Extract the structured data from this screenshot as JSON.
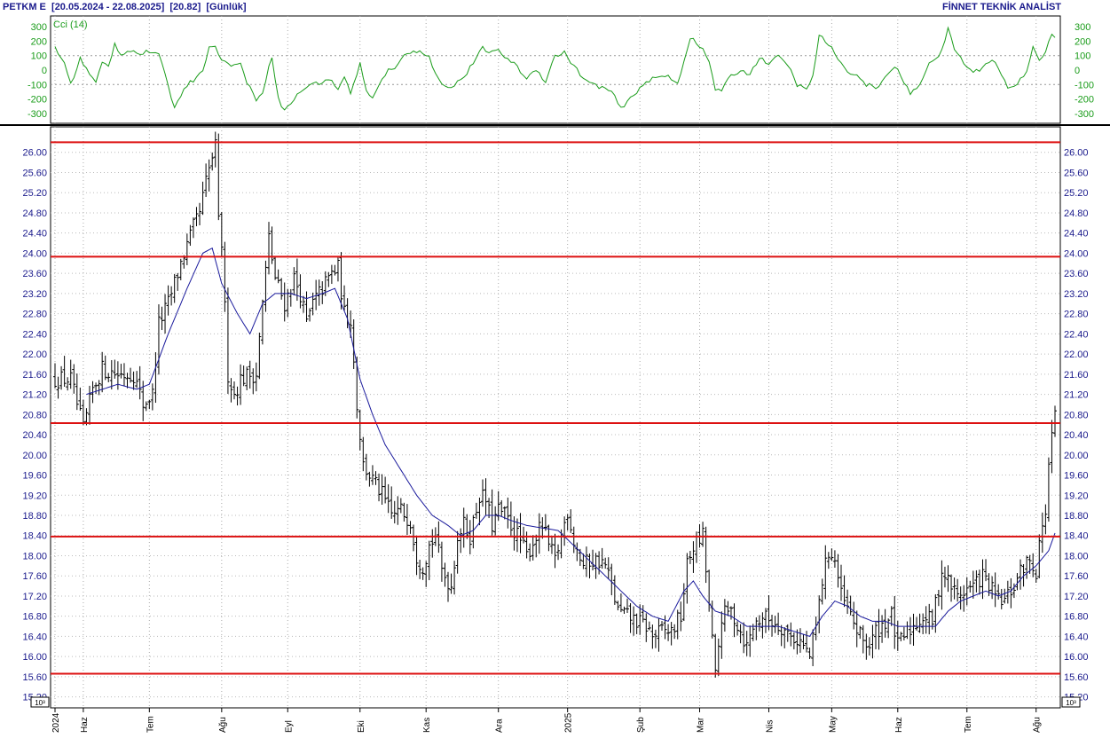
{
  "header": {
    "symbol": "PETKM E",
    "range": "[20.05.2024 - 22.08.2025]",
    "last": "[20.82]",
    "period": "[Günlük]",
    "source": "FİNNET TEKNİK ANALİST"
  },
  "cci_panel": {
    "label": "Cci (14)",
    "ylim": [
      -350,
      350
    ],
    "ticks": [
      300,
      200,
      100,
      0,
      -100,
      -200,
      -300
    ],
    "tick_labels": [
      "300",
      "200",
      "100",
      "0",
      "-100",
      "-200",
      "-300"
    ],
    "dotted_levels": [
      100,
      -100
    ],
    "color": "#1a9c1a"
  },
  "price_panel": {
    "ylim": [
      15.0,
      26.4
    ],
    "ticks": [
      15.2,
      15.6,
      16.0,
      16.4,
      16.8,
      17.2,
      17.6,
      18.0,
      18.4,
      18.8,
      19.2,
      19.6,
      20.0,
      20.4,
      20.8,
      21.2,
      21.6,
      22.0,
      22.4,
      22.8,
      23.2,
      23.6,
      24.0,
      24.4,
      24.8,
      25.2,
      25.6,
      26.0
    ],
    "tick_labels": [
      "15.20",
      "15.60",
      "16.00",
      "16.40",
      "16.80",
      "17.20",
      "17.60",
      "18.00",
      "18.40",
      "18.80",
      "19.20",
      "19.60",
      "20.00",
      "20.40",
      "20.80",
      "21.20",
      "21.60",
      "22.00",
      "22.40",
      "22.80",
      "23.20",
      "23.60",
      "24.00",
      "24.40",
      "24.80",
      "25.20",
      "25.60",
      "26.00"
    ],
    "multiplier_label": "10^3",
    "horizontal_lines": [
      26.2,
      23.93,
      20.63,
      18.38,
      15.66
    ],
    "line_color": "#dd1111",
    "ma_color": "#1a1a9c",
    "bar_color": "#000000"
  },
  "x_axis": {
    "labels": [
      "2024",
      "Haz",
      "Tem",
      "Ağu",
      "Eyl",
      "Eki",
      "Kas",
      "Ara",
      "2025",
      "Şub",
      "Mar",
      "Nis",
      "May",
      "Haz",
      "Tem",
      "Ağu"
    ],
    "label_index": [
      0,
      9,
      30,
      53,
      74,
      97,
      118,
      141,
      163,
      186,
      205,
      227,
      247,
      268,
      290,
      312
    ]
  },
  "chart_data": {
    "type": "ohlc",
    "price_keypoints": [
      [
        0,
        21.5
      ],
      [
        5,
        21.5
      ],
      [
        9,
        20.5
      ],
      [
        12,
        21.3
      ],
      [
        15,
        21.7
      ],
      [
        20,
        21.6
      ],
      [
        25,
        21.6
      ],
      [
        28,
        21.0
      ],
      [
        31,
        21.2
      ],
      [
        33,
        22.6
      ],
      [
        36,
        23.0
      ],
      [
        40,
        23.8
      ],
      [
        44,
        24.5
      ],
      [
        46,
        24.8
      ],
      [
        48,
        25.4
      ],
      [
        50,
        25.9
      ],
      [
        51,
        26.1
      ],
      [
        52,
        24.6
      ],
      [
        53,
        24.2
      ],
      [
        55,
        21.6
      ],
      [
        57,
        21.2
      ],
      [
        59,
        21.5
      ],
      [
        62,
        21.6
      ],
      [
        64,
        21.6
      ],
      [
        66,
        23.0
      ],
      [
        68,
        24.3
      ],
      [
        70,
        23.5
      ],
      [
        73,
        23.0
      ],
      [
        76,
        23.5
      ],
      [
        78,
        23.2
      ],
      [
        80,
        22.6
      ],
      [
        82,
        23.0
      ],
      [
        85,
        23.3
      ],
      [
        88,
        23.6
      ],
      [
        90,
        23.7
      ],
      [
        92,
        22.8
      ],
      [
        94,
        22.7
      ],
      [
        96,
        21.0
      ],
      [
        98,
        19.8
      ],
      [
        101,
        19.5
      ],
      [
        104,
        19.2
      ],
      [
        107,
        18.8
      ],
      [
        110,
        18.9
      ],
      [
        113,
        18.7
      ],
      [
        115,
        18.0
      ],
      [
        117,
        17.8
      ],
      [
        119,
        18.2
      ],
      [
        121,
        18.4
      ],
      [
        123,
        17.7
      ],
      [
        126,
        17.4
      ],
      [
        128,
        18.4
      ],
      [
        130,
        18.6
      ],
      [
        132,
        18.4
      ],
      [
        135,
        19.2
      ],
      [
        137,
        19.1
      ],
      [
        139,
        18.6
      ],
      [
        141,
        18.9
      ],
      [
        143,
        18.8
      ],
      [
        145,
        18.6
      ],
      [
        148,
        18.3
      ],
      [
        150,
        18.0
      ],
      [
        153,
        18.4
      ],
      [
        155,
        18.6
      ],
      [
        157,
        18.2
      ],
      [
        159,
        17.9
      ],
      [
        161,
        18.4
      ],
      [
        163,
        18.9
      ],
      [
        165,
        18.3
      ],
      [
        168,
        17.8
      ],
      [
        170,
        17.9
      ],
      [
        173,
        17.9
      ],
      [
        175,
        17.8
      ],
      [
        177,
        17.4
      ],
      [
        179,
        16.9
      ],
      [
        182,
        16.8
      ],
      [
        185,
        16.7
      ],
      [
        188,
        16.6
      ],
      [
        190,
        16.4
      ],
      [
        193,
        16.5
      ],
      [
        196,
        16.5
      ],
      [
        199,
        16.8
      ],
      [
        201,
        17.8
      ],
      [
        203,
        18.2
      ],
      [
        205,
        18.3
      ],
      [
        206,
        18.4
      ],
      [
        208,
        17.0
      ],
      [
        210,
        15.6
      ],
      [
        212,
        16.8
      ],
      [
        215,
        16.9
      ],
      [
        218,
        16.5
      ],
      [
        220,
        16.2
      ],
      [
        222,
        16.6
      ],
      [
        225,
        16.8
      ],
      [
        228,
        16.7
      ],
      [
        231,
        16.6
      ],
      [
        234,
        16.4
      ],
      [
        237,
        16.3
      ],
      [
        240,
        16.0
      ],
      [
        242,
        16.6
      ],
      [
        244,
        17.5
      ],
      [
        246,
        18.1
      ],
      [
        248,
        17.9
      ],
      [
        250,
        17.2
      ],
      [
        253,
        16.8
      ],
      [
        256,
        16.4
      ],
      [
        259,
        16.2
      ],
      [
        261,
        16.5
      ],
      [
        264,
        16.7
      ],
      [
        266,
        16.8
      ],
      [
        268,
        16.2
      ],
      [
        270,
        16.4
      ],
      [
        273,
        16.6
      ],
      [
        276,
        16.8
      ],
      [
        279,
        16.7
      ],
      [
        282,
        17.7
      ],
      [
        284,
        17.5
      ],
      [
        287,
        17.2
      ],
      [
        289,
        17.3
      ],
      [
        292,
        17.4
      ],
      [
        295,
        17.6
      ],
      [
        297,
        17.4
      ],
      [
        300,
        17.1
      ],
      [
        302,
        17.1
      ],
      [
        305,
        17.4
      ],
      [
        308,
        17.8
      ],
      [
        310,
        17.9
      ],
      [
        312,
        17.7
      ],
      [
        313,
        18.3
      ],
      [
        314,
        18.5
      ],
      [
        315,
        18.9
      ],
      [
        316,
        19.8
      ],
      [
        317,
        20.3
      ],
      [
        318,
        20.82
      ]
    ],
    "ma_keypoints": [
      [
        10,
        21.2
      ],
      [
        20,
        21.4
      ],
      [
        26,
        21.3
      ],
      [
        30,
        21.4
      ],
      [
        36,
        22.4
      ],
      [
        42,
        23.3
      ],
      [
        47,
        24.0
      ],
      [
        50,
        24.1
      ],
      [
        53,
        23.4
      ],
      [
        58,
        22.8
      ],
      [
        62,
        22.4
      ],
      [
        66,
        23.0
      ],
      [
        70,
        23.2
      ],
      [
        75,
        23.2
      ],
      [
        80,
        23.1
      ],
      [
        85,
        23.2
      ],
      [
        89,
        23.3
      ],
      [
        93,
        22.7
      ],
      [
        97,
        21.5
      ],
      [
        101,
        20.8
      ],
      [
        105,
        20.2
      ],
      [
        110,
        19.7
      ],
      [
        115,
        19.2
      ],
      [
        120,
        18.8
      ],
      [
        125,
        18.6
      ],
      [
        129,
        18.4
      ],
      [
        133,
        18.5
      ],
      [
        137,
        18.8
      ],
      [
        141,
        18.8
      ],
      [
        145,
        18.7
      ],
      [
        150,
        18.6
      ],
      [
        155,
        18.55
      ],
      [
        160,
        18.5
      ],
      [
        165,
        18.2
      ],
      [
        170,
        17.9
      ],
      [
        175,
        17.6
      ],
      [
        180,
        17.3
      ],
      [
        185,
        17.0
      ],
      [
        190,
        16.8
      ],
      [
        195,
        16.7
      ],
      [
        200,
        17.3
      ],
      [
        203,
        17.5
      ],
      [
        206,
        17.2
      ],
      [
        210,
        16.9
      ],
      [
        215,
        16.8
      ],
      [
        220,
        16.6
      ],
      [
        225,
        16.6
      ],
      [
        230,
        16.6
      ],
      [
        235,
        16.5
      ],
      [
        240,
        16.4
      ],
      [
        244,
        16.8
      ],
      [
        248,
        17.1
      ],
      [
        252,
        17.0
      ],
      [
        256,
        16.8
      ],
      [
        260,
        16.7
      ],
      [
        264,
        16.7
      ],
      [
        268,
        16.6
      ],
      [
        272,
        16.6
      ],
      [
        276,
        16.6
      ],
      [
        280,
        16.6
      ],
      [
        284,
        16.9
      ],
      [
        288,
        17.1
      ],
      [
        292,
        17.2
      ],
      [
        296,
        17.3
      ],
      [
        300,
        17.2
      ],
      [
        304,
        17.3
      ],
      [
        308,
        17.6
      ],
      [
        312,
        17.8
      ],
      [
        316,
        18.1
      ],
      [
        318,
        18.45
      ]
    ],
    "cci_keypoints": [
      [
        0,
        150
      ],
      [
        3,
        50
      ],
      [
        5,
        -100
      ],
      [
        8,
        80
      ],
      [
        11,
        -30
      ],
      [
        13,
        -90
      ],
      [
        15,
        50
      ],
      [
        17,
        30
      ],
      [
        19,
        180
      ],
      [
        21,
        110
      ],
      [
        24,
        140
      ],
      [
        27,
        110
      ],
      [
        30,
        130
      ],
      [
        33,
        100
      ],
      [
        36,
        -100
      ],
      [
        38,
        -270
      ],
      [
        41,
        -120
      ],
      [
        44,
        -70
      ],
      [
        47,
        10
      ],
      [
        49,
        150
      ],
      [
        51,
        160
      ],
      [
        53,
        80
      ],
      [
        56,
        20
      ],
      [
        59,
        60
      ],
      [
        61,
        -90
      ],
      [
        64,
        -200
      ],
      [
        66,
        -150
      ],
      [
        69,
        100
      ],
      [
        71,
        -200
      ],
      [
        73,
        -280
      ],
      [
        75,
        -230
      ],
      [
        78,
        -150
      ],
      [
        81,
        -100
      ],
      [
        84,
        -90
      ],
      [
        87,
        -60
      ],
      [
        90,
        -130
      ],
      [
        92,
        -40
      ],
      [
        94,
        -170
      ],
      [
        97,
        50
      ],
      [
        99,
        -150
      ],
      [
        101,
        -200
      ],
      [
        103,
        -110
      ],
      [
        106,
        0
      ],
      [
        108,
        20
      ],
      [
        110,
        80
      ],
      [
        113,
        120
      ],
      [
        116,
        140
      ],
      [
        119,
        90
      ],
      [
        121,
        -30
      ],
      [
        124,
        -120
      ],
      [
        127,
        -100
      ],
      [
        130,
        -50
      ],
      [
        133,
        50
      ],
      [
        136,
        150
      ],
      [
        139,
        120
      ],
      [
        141,
        130
      ],
      [
        144,
        80
      ],
      [
        147,
        20
      ],
      [
        150,
        -60
      ],
      [
        153,
        10
      ],
      [
        156,
        -80
      ],
      [
        159,
        100
      ],
      [
        162,
        120
      ],
      [
        165,
        30
      ],
      [
        168,
        -60
      ],
      [
        171,
        -100
      ],
      [
        174,
        -120
      ],
      [
        177,
        -150
      ],
      [
        180,
        -270
      ],
      [
        183,
        -200
      ],
      [
        186,
        -120
      ],
      [
        189,
        -70
      ],
      [
        192,
        -50
      ],
      [
        195,
        -40
      ],
      [
        198,
        -90
      ],
      [
        200,
        60
      ],
      [
        202,
        230
      ],
      [
        204,
        180
      ],
      [
        206,
        140
      ],
      [
        208,
        60
      ],
      [
        210,
        -130
      ],
      [
        212,
        -150
      ],
      [
        215,
        -30
      ],
      [
        218,
        -10
      ],
      [
        221,
        -20
      ],
      [
        224,
        80
      ],
      [
        227,
        50
      ],
      [
        230,
        90
      ],
      [
        233,
        40
      ],
      [
        236,
        -100
      ],
      [
        239,
        -140
      ],
      [
        241,
        -40
      ],
      [
        243,
        240
      ],
      [
        245,
        200
      ],
      [
        247,
        150
      ],
      [
        249,
        60
      ],
      [
        252,
        0
      ],
      [
        255,
        -40
      ],
      [
        258,
        -100
      ],
      [
        261,
        -120
      ],
      [
        264,
        -60
      ],
      [
        267,
        30
      ],
      [
        270,
        -80
      ],
      [
        272,
        -170
      ],
      [
        275,
        -100
      ],
      [
        278,
        60
      ],
      [
        281,
        80
      ],
      [
        284,
        280
      ],
      [
        286,
        150
      ],
      [
        289,
        50
      ],
      [
        292,
        -20
      ],
      [
        295,
        20
      ],
      [
        298,
        80
      ],
      [
        300,
        10
      ],
      [
        303,
        -120
      ],
      [
        306,
        -100
      ],
      [
        309,
        0
      ],
      [
        311,
        160
      ],
      [
        313,
        80
      ],
      [
        315,
        120
      ],
      [
        317,
        250
      ],
      [
        318,
        220
      ]
    ]
  }
}
